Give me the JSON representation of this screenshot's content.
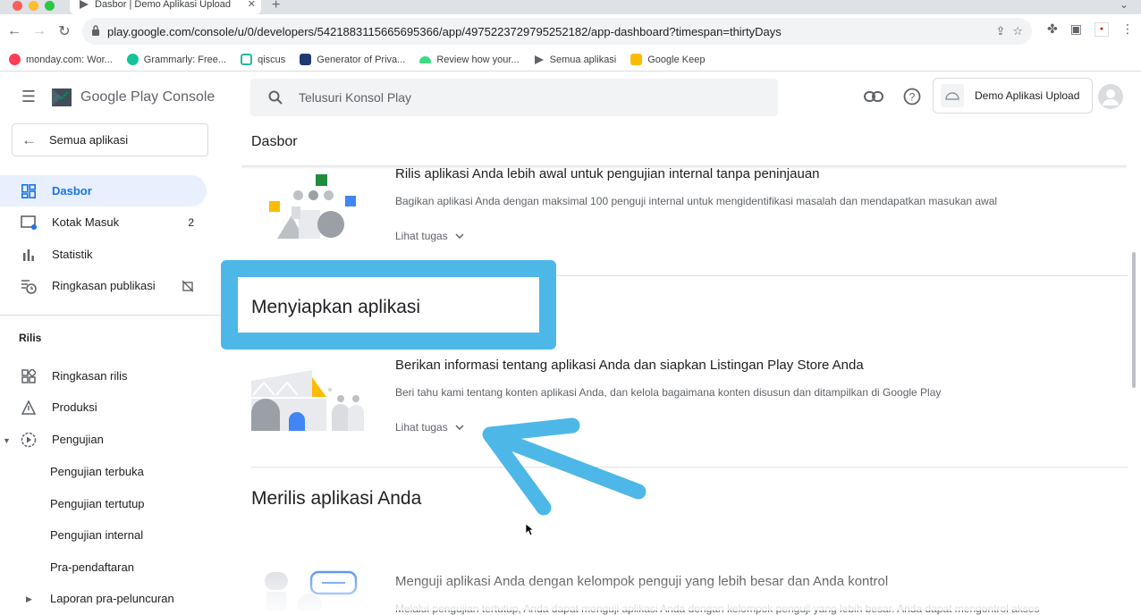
{
  "browser": {
    "tab_title": "Dasbor | Demo Aplikasi Upload",
    "new_tab": "+",
    "url": "play.google.com/console/u/0/developers/5421883115665695366/app/4975223729795252182/app-dashboard?timespan=thirtyDays",
    "bookmarks": [
      {
        "label": "monday.com: Wor...",
        "color": "#ff3d57"
      },
      {
        "label": "Grammarly: Free...",
        "color": "#15c39a"
      },
      {
        "label": "qiscus",
        "color": "#27b6a2"
      },
      {
        "label": "Generator of Priva...",
        "color": "#1f3b73"
      },
      {
        "label": "Review how your...",
        "color": "#3ddc84"
      },
      {
        "label": "Semua aplikasi",
        "color": "#5f6368"
      },
      {
        "label": "Google Keep",
        "color": "#fbbc04"
      }
    ]
  },
  "header": {
    "logo_text": "Google Play Console",
    "search_placeholder": "Telusuri Konsol Play",
    "app_name": "Demo Aplikasi Upload"
  },
  "sidebar": {
    "back_label": "Semua aplikasi",
    "items": [
      {
        "label": "Dasbor",
        "icon": "dashboard-icon"
      },
      {
        "label": "Kotak Masuk",
        "icon": "inbox-icon",
        "count": "2"
      },
      {
        "label": "Statistik",
        "icon": "bar-chart-icon"
      },
      {
        "label": "Ringkasan publikasi",
        "icon": "publishing-overview-icon"
      }
    ],
    "section_label": "Rilis",
    "release_items": [
      {
        "label": "Ringkasan rilis",
        "icon": "releases-overview-icon"
      },
      {
        "label": "Produksi",
        "icon": "production-icon"
      },
      {
        "label": "Pengujian",
        "icon": "testing-icon"
      }
    ],
    "testing_sub": [
      "Pengujian terbuka",
      "Pengujian tertutup",
      "Pengujian internal",
      "Pra-pendaftaran"
    ],
    "pre_launch": "Laporan pra-peluncuran"
  },
  "main": {
    "page_title": "Dasbor",
    "task1": {
      "title": "Rilis aplikasi Anda lebih awal untuk pengujian internal tanpa peninjauan",
      "desc": "Bagikan aplikasi Anda dengan maksimal 100 penguji internal untuk mengidentifikasi masalah dan mendapatkan masukan awal",
      "link": "Lihat tugas"
    },
    "section_setup": "Menyiapkan aplikasi",
    "task2": {
      "title": "Berikan informasi tentang aplikasi Anda dan siapkan Listingan Play Store Anda",
      "desc": "Beri tahu kami tentang konten aplikasi Anda, dan kelola bagaimana konten disusun dan ditampilkan di Google Play",
      "link": "Lihat tugas"
    },
    "section_release": "Merilis aplikasi Anda",
    "task3": {
      "title": "Menguji aplikasi Anda dengan kelompok penguji yang lebih besar dan Anda kontrol",
      "desc": "Melalui pengujian tertutup, Anda dapat menguji aplikasi Anda dengan kelompok penguji yang lebih besar. Anda dapat mengontrol akses"
    }
  },
  "colors": {
    "accent": "#1a73e8",
    "highlight": "#4db8e8",
    "active_bg": "#e8f0fe"
  }
}
